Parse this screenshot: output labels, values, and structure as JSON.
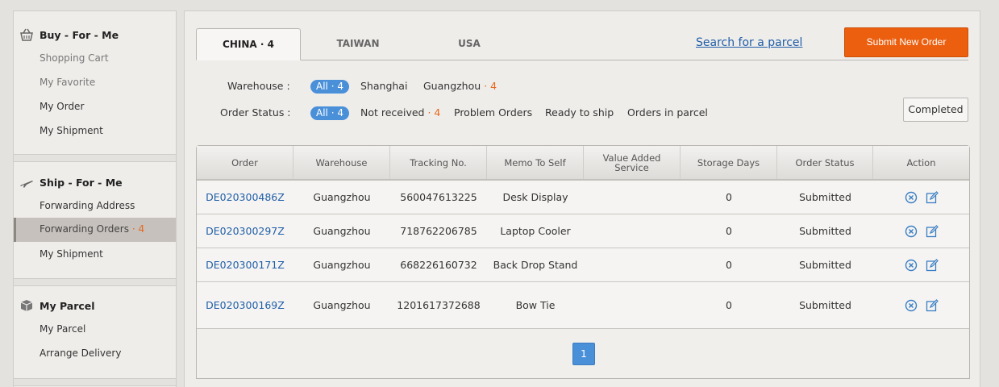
{
  "sidebar": {
    "buy": {
      "heading": "Buy - For - Me",
      "icon": "basket-icon",
      "items": [
        "Shopping Cart",
        "My Favorite",
        "My Order",
        "My Shipment"
      ]
    },
    "ship": {
      "heading": "Ship - For - Me",
      "icon": "airplane-icon",
      "items": [
        "Forwarding Address",
        "Forwarding Orders",
        "My Shipment"
      ],
      "forwarding_orders_count": "4"
    },
    "parcel": {
      "heading": "My Parcel",
      "icon": "box-icon",
      "items": [
        "My Parcel",
        "Arrange Delivery"
      ]
    }
  },
  "tabs": [
    {
      "label": "CHINA · 4",
      "active": true
    },
    {
      "label": "TAIWAN",
      "active": false
    },
    {
      "label": "USA",
      "active": false
    }
  ],
  "search_link": "Search for a parcel",
  "submit_button": "Submit New Order",
  "filters": {
    "warehouse": {
      "label": "Warehouse :",
      "all": "All · 4",
      "options": [
        {
          "name": "Shanghai",
          "count": ""
        },
        {
          "name": "Guangzhou",
          "count": "· 4"
        }
      ]
    },
    "status": {
      "label": "Order Status :",
      "all": "All · 4",
      "options": [
        {
          "name": "Not received",
          "count": "· 4"
        },
        {
          "name": "Problem Orders",
          "count": ""
        },
        {
          "name": "Ready to ship",
          "count": ""
        },
        {
          "name": "Orders in parcel",
          "count": ""
        }
      ]
    },
    "completed_button": "Completed"
  },
  "table": {
    "headers": [
      "Order",
      "Warehouse",
      "Tracking No.",
      "Memo To Self",
      "Value Added Service",
      "Storage Days",
      "Order Status",
      "Action"
    ],
    "rows": [
      {
        "order": "DE020300486Z",
        "warehouse": "Guangzhou",
        "tracking": "560047613225",
        "memo": "Desk Display",
        "vas": "",
        "days": "0",
        "status": "Submitted"
      },
      {
        "order": "DE020300297Z",
        "warehouse": "Guangzhou",
        "tracking": "718762206785",
        "memo": "Laptop Cooler",
        "vas": "",
        "days": "0",
        "status": "Submitted"
      },
      {
        "order": "DE020300171Z",
        "warehouse": "Guangzhou",
        "tracking": "668226160732",
        "memo": "Back Drop Stand",
        "vas": "",
        "days": "0",
        "status": "Submitted"
      },
      {
        "order": "DE020300169Z",
        "warehouse": "Guangzhou",
        "tracking": "1201617372688",
        "memo": "Bow Tie",
        "vas": "",
        "days": "0",
        "status": "Submitted"
      }
    ]
  },
  "pagination": {
    "current": "1"
  },
  "colors": {
    "accent_orange": "#ec5f0f",
    "pill_blue": "#4a90d9",
    "link_blue": "#1f5ea8"
  }
}
